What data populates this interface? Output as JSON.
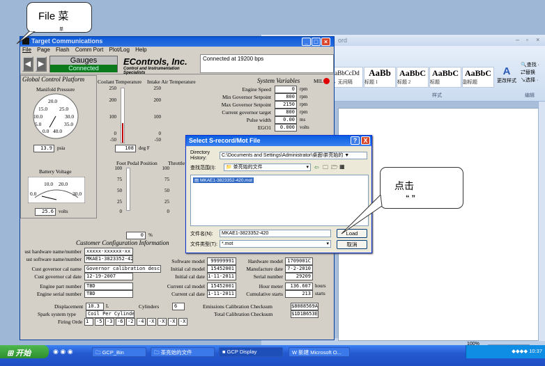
{
  "callout_top": {
    "text": "File 菜",
    "text2": "单"
  },
  "callout_right": {
    "text": "点击",
    "text2": "“    ”"
  },
  "word": {
    "title_fragment": "ord",
    "styles": [
      {
        "big": "aBbCcDd",
        "lbl": "→ 无间隔"
      },
      {
        "big": "AaBb",
        "lbl": "标题 1"
      },
      {
        "big": "AaBbC",
        "lbl": "标题 2"
      },
      {
        "big": "AaBbC",
        "lbl": "标题"
      },
      {
        "big": "AaBbC",
        "lbl": "副标题"
      }
    ],
    "find": "查找 ·",
    "replace": "替换",
    "select": "选择 ·",
    "change_styles": "更改样式",
    "section_styles": "样式",
    "section_edit": "编辑",
    "zoom": "100%"
  },
  "gcp": {
    "title": "Target Communications",
    "menu": [
      "File",
      "Page",
      "Flash",
      "Comm Port",
      "Plot/Log",
      "Help"
    ],
    "gauges": "Gauges",
    "connected": "Connected",
    "brand": "EControls, Inc.",
    "brand_sub": "Control and Instrumentation Specialists",
    "conn_status": "Connected at 19200 bps",
    "global_title": "Global Control Platform",
    "manifold_label": "Manifold Pressure",
    "manifold_ticks": [
      "20.0",
      "15.0",
      "25.0",
      "10.0",
      "30.0",
      "5.0",
      "35.0",
      "0.0",
      "40.0"
    ],
    "manifold_value": "13.9",
    "manifold_unit": "psia",
    "battery_label": "Battery Voltage",
    "battery_ticks": [
      "10.0",
      "20.0",
      "0.0",
      "30.0"
    ],
    "battery_value": "25.6",
    "battery_unit": "volts",
    "coolant_label": "Coolant Temperature",
    "iat_label": "Intake Air Temperature",
    "temp_ticks": [
      "250",
      "200",
      "100",
      "0",
      "-50"
    ],
    "coolant_value": "108",
    "coolant_unit": "deg F",
    "pedal_label": "Foot Pedal Position",
    "throttle_label": "Throttle",
    "pedal_ticks": [
      "100",
      "75",
      "50",
      "25",
      "0"
    ],
    "pedal_value": "0",
    "pedal_unit": "%",
    "sysvars_title": "System Variables",
    "mil": "MIL",
    "sysvars": [
      {
        "label": "Engine Speed",
        "value": "0",
        "unit": "rpm"
      },
      {
        "label": "Min Governor Setpoint",
        "value": "800",
        "unit": "rpm"
      },
      {
        "label": "Max Governor Setpoint",
        "value": "2150",
        "unit": "rpm"
      },
      {
        "label": "Current governor target",
        "value": "800",
        "unit": "rpm"
      },
      {
        "label": "Pulse width",
        "value": "0.00",
        "unit": "ms"
      },
      {
        "label": "EGO1",
        "value": "0.000",
        "unit": "volts"
      }
    ],
    "cust_title": "Customer Configuration Information",
    "cust_left": [
      {
        "label": "ust hardware name/number",
        "value": "xxxxx-xxxxxx-xx"
      },
      {
        "label": "ust software name/number",
        "value": "MKAE1-3823352-420"
      },
      {
        "label": "Cust governor cal name",
        "value": "Governor calibration description"
      },
      {
        "label": "Cust governor cal date",
        "value": "12-19-2007"
      },
      {
        "label": "Engine part number",
        "value": "TBD"
      },
      {
        "label": "Engine serial number",
        "value": "TBD"
      }
    ],
    "displacement_label": "Displacement",
    "displacement": "10.3",
    "disp_unit": "L",
    "cyl_label": "Cylinders",
    "cylinders": "6",
    "spark_label": "Spark system type",
    "spark": "Coil Per Cylinder",
    "firing_label": "Firing Orde",
    "firing": [
      "1",
      "-5",
      "-3",
      "-6",
      "-2",
      "-4",
      "-X",
      "-X",
      "-X",
      "-X"
    ],
    "cust_mid": [
      {
        "label": "Software model",
        "value": "99999991"
      },
      {
        "label": "Initial cal model",
        "value": "15452001"
      },
      {
        "label": "Initial cal date",
        "value": "1-11-2011"
      },
      {
        "label": "Current cal model",
        "value": "15452001"
      },
      {
        "label": "Current cal date",
        "value": "1-11-2011"
      }
    ],
    "cust_right": [
      {
        "label": "Hardware model",
        "value": "1709001C",
        "unit": ""
      },
      {
        "label": "Manufacture date",
        "value": "7-2-2010",
        "unit": ""
      },
      {
        "label": "Serial number",
        "value": "29209",
        "unit": ""
      },
      {
        "label": "Hour meter",
        "value": "136.607",
        "unit": "hours"
      },
      {
        "label": "Cumulative starts",
        "value": "213",
        "unit": "starts"
      }
    ],
    "emission_label": "Emissions Calibration Checksum",
    "emission": "$8088569A",
    "total_label": "Total Calibration Checksum",
    "total": "$1D1B653E"
  },
  "dialog": {
    "title": "Select S-record/Mot File",
    "dir_label": "Directory",
    "dir_label2": "History:",
    "dir_value": "C:\\Documents and Settings\\Administrator\\桌面\\茶亮始的 ▼",
    "lookin_label": "查找范围(I):",
    "lookin_value": "📁 茶亮始的文件",
    "file": "MKAE1-3823352-420.mot",
    "filename_label": "文件名(N):",
    "filename_value": "MKAE1-3823352-420",
    "filetype_label": "文件类型(T):",
    "filetype_value": "*.mot",
    "load": "Load",
    "cancel": "取消",
    "help": "?",
    "close": "X"
  },
  "taskbar": {
    "start": "开始",
    "tasks": [
      "GCP_Bin",
      "茶亮始的文件",
      "GCP Display",
      "新建 Microsoft O..."
    ],
    "time": "10:37"
  }
}
